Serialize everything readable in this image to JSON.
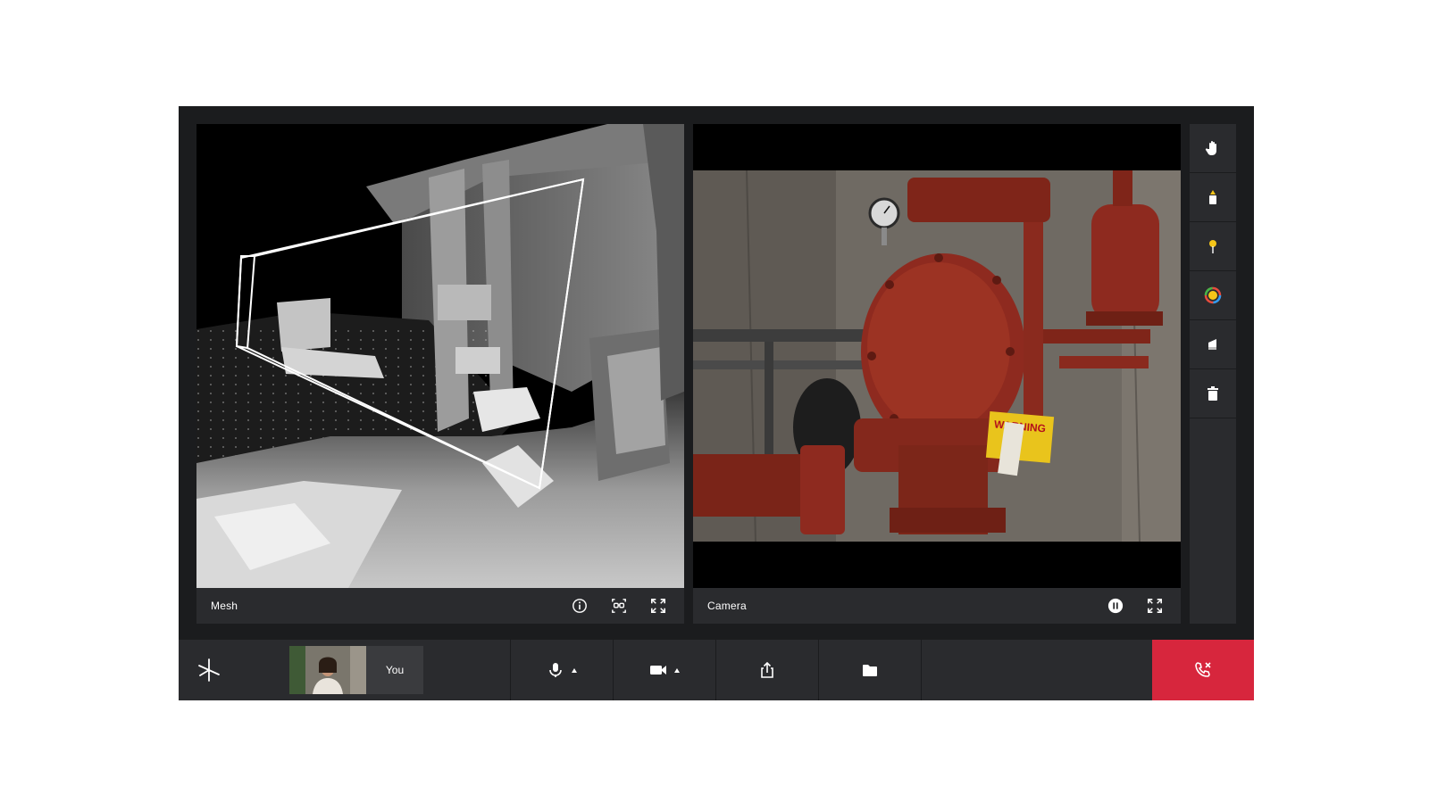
{
  "mesh_panel": {
    "label": "Mesh",
    "icons": [
      "info-icon",
      "ar-glasses-icon",
      "fullscreen-icon"
    ]
  },
  "camera_panel": {
    "label": "Camera",
    "icons": [
      "pause-icon",
      "fullscreen-icon"
    ],
    "scene": {
      "tag_text": "WARNING"
    }
  },
  "annotation_tools": [
    "hand-pointer-icon",
    "highlighter-icon",
    "pin-icon",
    "color-picker-icon",
    "eraser-icon",
    "trash-icon"
  ],
  "bottom_bar": {
    "logo": "asterisk-logo-icon",
    "self_view": {
      "label": "You"
    },
    "controls": [
      "microphone-icon",
      "video-camera-icon",
      "share-screen-icon",
      "folder-icon"
    ],
    "end_call": "end-call-icon"
  },
  "colors": {
    "frame_background": "#1b1c1e",
    "panel_background": "#2a2b2e",
    "end_call_red": "#d7263d",
    "highlighter_yellow": "#f5c518",
    "pipe_red": "#8e2a1f"
  }
}
